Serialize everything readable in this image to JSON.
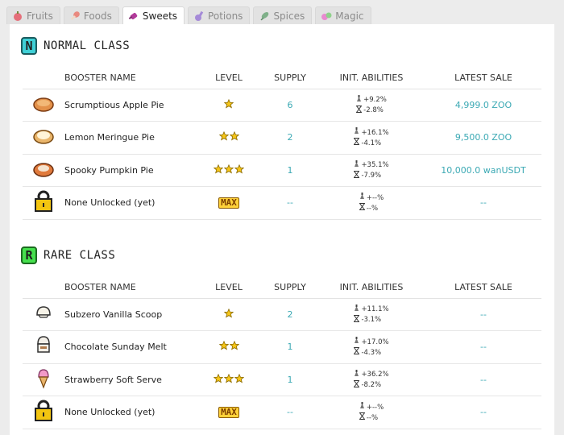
{
  "tabs": [
    {
      "label": "Fruits",
      "icon": "fruit-icon",
      "active": false
    },
    {
      "label": "Foods",
      "icon": "drumstick-icon",
      "active": false
    },
    {
      "label": "Sweets",
      "icon": "candy-icon",
      "active": true
    },
    {
      "label": "Potions",
      "icon": "potion-icon",
      "active": false
    },
    {
      "label": "Spices",
      "icon": "leaf-icon",
      "active": false
    },
    {
      "label": "Magic",
      "icon": "orbs-icon",
      "active": false
    }
  ],
  "columns": {
    "name": "BOOSTER NAME",
    "level": "LEVEL",
    "supply": "SUPPLY",
    "abilities": "INIT. ABILITIES",
    "sale": "LATEST SALE"
  },
  "normal": {
    "badge": "N",
    "title": "NORMAL CLASS",
    "rows": [
      {
        "icon": "apple-pie-icon",
        "name": "Scrumptious Apple Pie",
        "stars": 1,
        "supply": "6",
        "up": "+9.2%",
        "down": "-2.8%",
        "sale": "4,999.0 ZOO"
      },
      {
        "icon": "meringue-pie-icon",
        "name": "Lemon Meringue Pie",
        "stars": 2,
        "supply": "2",
        "up": "+16.1%",
        "down": "-4.1%",
        "sale": "9,500.0 ZOO"
      },
      {
        "icon": "pumpkin-pie-icon",
        "name": "Spooky Pumpkin Pie",
        "stars": 3,
        "supply": "1",
        "up": "+35.1%",
        "down": "-7.9%",
        "sale": "10,000.0 wanUSDT"
      },
      {
        "icon": "lock-icon",
        "name": "None Unlocked (yet)",
        "max": "MAX",
        "supply": "--",
        "up": "+--%",
        "down": "--%",
        "sale": "--"
      }
    ]
  },
  "rare": {
    "badge": "R",
    "title": "RARE CLASS",
    "rows": [
      {
        "icon": "vanilla-scoop-icon",
        "name": "Subzero Vanilla Scoop",
        "stars": 1,
        "supply": "2",
        "up": "+11.1%",
        "down": "-3.1%",
        "sale": "--"
      },
      {
        "icon": "sundae-icon",
        "name": "Chocolate Sunday Melt",
        "stars": 2,
        "supply": "1",
        "up": "+17.0%",
        "down": "-4.3%",
        "sale": "--"
      },
      {
        "icon": "soft-serve-icon",
        "name": "Strawberry Soft Serve",
        "stars": 3,
        "supply": "1",
        "up": "+36.2%",
        "down": "-8.2%",
        "sale": "--"
      },
      {
        "icon": "lock-icon",
        "name": "None Unlocked (yet)",
        "max": "MAX",
        "supply": "--",
        "up": "+--%",
        "down": "--%",
        "sale": "--"
      }
    ]
  },
  "colors": {
    "accent": "#3ba9b4",
    "normal_badge": "#3fd0d6",
    "rare_badge": "#45e04d",
    "star": "#f5c518"
  }
}
